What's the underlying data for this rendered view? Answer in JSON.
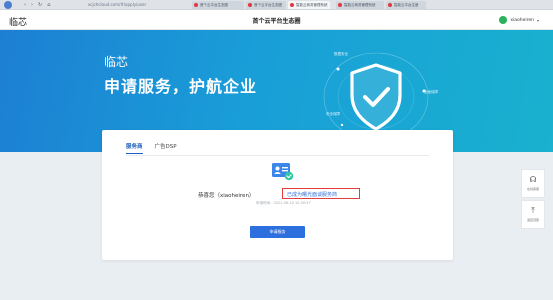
{
  "browser": {
    "url": "xcjchcloud.com/#/apply/user",
    "nav_glyphs": [
      "‹",
      "›",
      "↻",
      "⌂"
    ],
    "tabs": [
      {
        "label": "首个云平台生态圈"
      },
      {
        "label": "首个云平台生态圈"
      },
      {
        "label": "智能云商务管理系统"
      },
      {
        "label": "智能云商务管理系统"
      },
      {
        "label": "智能云平台注册"
      }
    ]
  },
  "header": {
    "logo_text": "临芯",
    "title": "首个云平台生态圈",
    "user_name": "xiaoheiren",
    "caret": "▾"
  },
  "hero": {
    "logo_text": "临芯",
    "slogan": "申请服务，护航企业",
    "labels": [
      "数据安全",
      "全面保障",
      "安全保障"
    ]
  },
  "card": {
    "tabs": [
      "服务商",
      "广告DSP"
    ],
    "active_tab": 0,
    "congrats_text": "恭喜您（xiaoheiren）",
    "status_text": "已成为曙光面谈服务商",
    "apply_time": "申请时间：2021-06-10 12:30:57",
    "apply_button": "申请服务"
  },
  "float_panel": {
    "items": [
      {
        "icon": "headset-icon",
        "glyph": "☊",
        "label": "在线客服"
      },
      {
        "icon": "back-to-top-icon",
        "glyph": "⤒",
        "label": "返回顶部"
      }
    ]
  },
  "colors": {
    "hero_start": "#1d7fd3",
    "hero_end": "#19b1cf",
    "primary": "#2e6fe0",
    "highlight_border": "#e23c3c",
    "status_text": "#2f6fdc"
  }
}
